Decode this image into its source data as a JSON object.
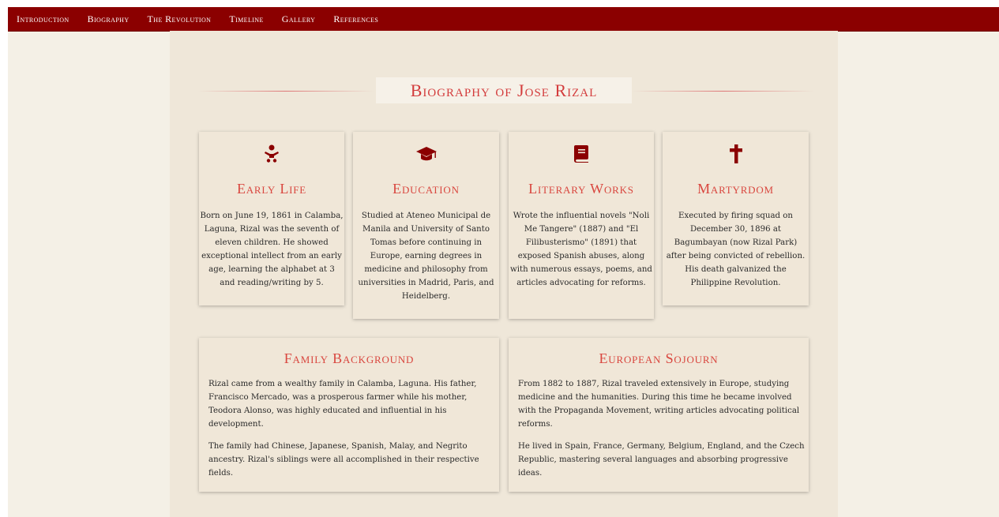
{
  "nav": {
    "items": [
      {
        "label": "Introduction"
      },
      {
        "label": "Biography"
      },
      {
        "label": "The Revolution"
      },
      {
        "label": "Timeline"
      },
      {
        "label": "Gallery"
      },
      {
        "label": "References"
      }
    ]
  },
  "page": {
    "title": "Biography of Jose Rizal"
  },
  "cards": [
    {
      "icon": "baby-icon",
      "title": "Early Life",
      "text": "Born on June 19, 1861 in Calamba, Laguna, Rizal was the seventh of eleven children. He showed exceptional intellect from an early age, learning the alphabet at 3 and reading/writing by 5."
    },
    {
      "icon": "graduation-cap-icon",
      "title": "Education",
      "text": "Studied at Ateneo Municipal de Manila and University of Santo Tomas before continuing in Europe, earning degrees in medicine and philosophy from universities in Madrid, Paris, and Heidelberg."
    },
    {
      "icon": "book-icon",
      "title": "Literary Works",
      "text": "Wrote the influential novels \"Noli Me Tangere\" (1887) and \"El Filibusterismo\" (1891) that exposed Spanish abuses, along with numerous essays, poems, and articles advocating for reforms."
    },
    {
      "icon": "cross-icon",
      "title": "Martyrdom",
      "text": "Executed by firing squad on December 30, 1896 at Bagumbayan (now Rizal Park) after being convicted of rebellion. His death galvanized the Philippine Revolution."
    }
  ],
  "wide_cards": [
    {
      "title": "Family Background",
      "paragraphs": [
        "Rizal came from a wealthy family in Calamba, Laguna. His father, Francisco Mercado, was a prosperous farmer while his mother, Teodora Alonso, was highly educated and influential in his development.",
        "The family had Chinese, Japanese, Spanish, Malay, and Negrito ancestry. Rizal's siblings were all accomplished in their respective fields."
      ]
    },
    {
      "title": "European Sojourn",
      "paragraphs": [
        "From 1882 to 1887, Rizal traveled extensively in Europe, studying medicine and the humanities. During this time he became involved with the Propaganda Movement, writing articles advocating political reforms.",
        "He lived in Spain, France, Germany, Belgium, England, and the Czech Republic, mastering several languages and absorbing progressive ideas."
      ]
    }
  ],
  "colors": {
    "nav_bg": "#8b0000",
    "accent": "#d9473f",
    "icon": "#8b0000",
    "page_bg": "#f4f0e6",
    "content_bg": "#efe7d9"
  }
}
